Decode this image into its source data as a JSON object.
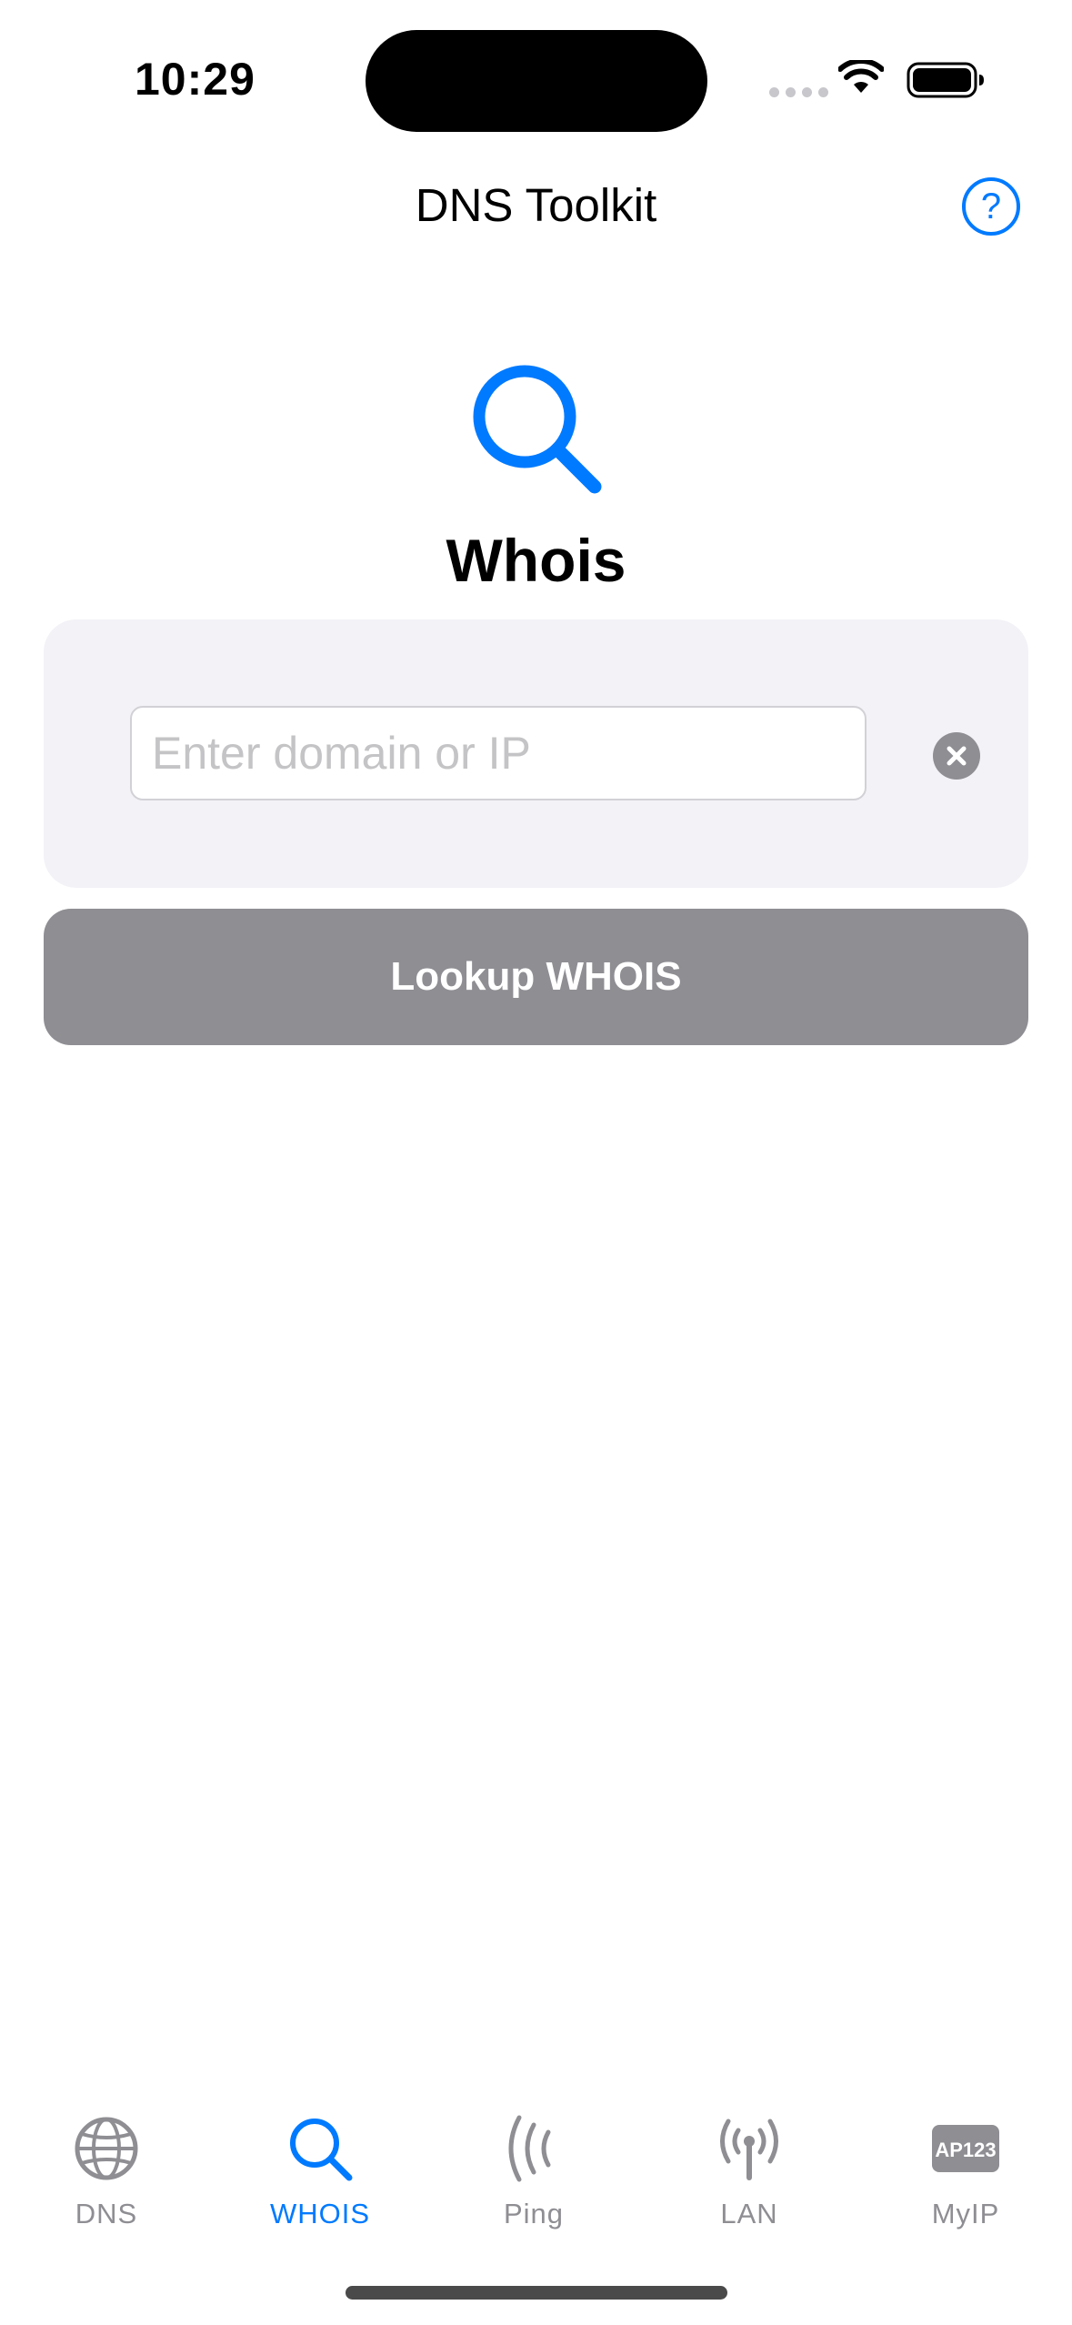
{
  "status_bar": {
    "time": "10:29"
  },
  "nav": {
    "title": "DNS Toolkit",
    "help_symbol": "?"
  },
  "hero": {
    "icon": "magnifying-glass-icon",
    "title": "Whois"
  },
  "input": {
    "placeholder": "Enter domain or IP",
    "value": ""
  },
  "lookup_button": {
    "label": "Lookup WHOIS",
    "enabled": false
  },
  "tabs": [
    {
      "label": "DNS",
      "icon": "globe-icon",
      "active": false
    },
    {
      "label": "WHOIS",
      "icon": "magnifying-glass-icon",
      "active": true
    },
    {
      "label": "Ping",
      "icon": "ping-waves-icon",
      "active": false
    },
    {
      "label": "LAN",
      "icon": "antenna-icon",
      "active": false
    },
    {
      "label": "MyIP",
      "icon": "ap123-icon",
      "active": false,
      "icon_text": "AP123"
    }
  ],
  "colors": {
    "accent": "#007aff",
    "inactive": "#8e8e93",
    "card_background": "#f2f2f7",
    "disabled_button": "#8e8e93"
  }
}
